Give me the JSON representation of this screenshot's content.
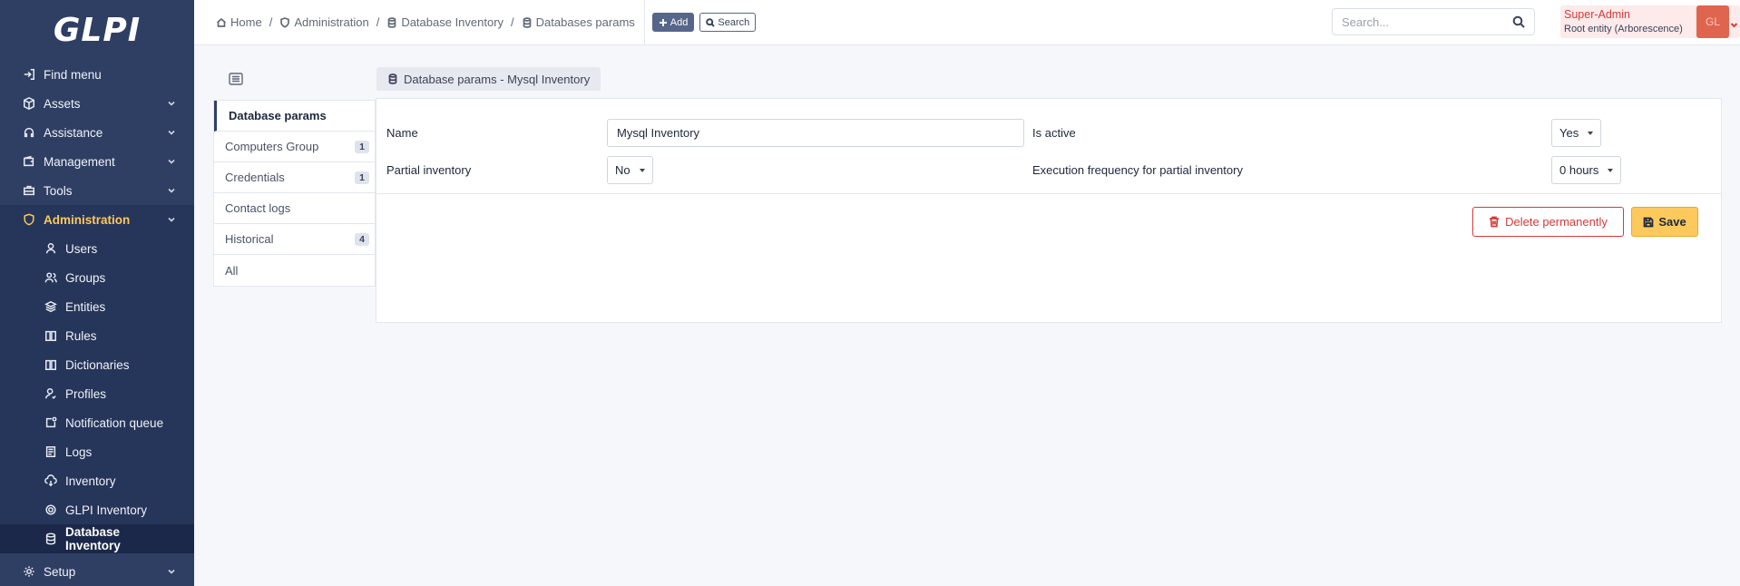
{
  "app": {
    "logo_text": "GLPI"
  },
  "sidebar": {
    "items": [
      {
        "label": "Find menu",
        "icon": "find-menu-icon"
      },
      {
        "label": "Assets",
        "icon": "cube-icon"
      },
      {
        "label": "Assistance",
        "icon": "headset-icon"
      },
      {
        "label": "Management",
        "icon": "wallet-icon"
      },
      {
        "label": "Tools",
        "icon": "briefcase-icon"
      },
      {
        "label": "Administration",
        "icon": "shield-icon"
      }
    ],
    "admin_subitems": [
      {
        "label": "Users",
        "icon": "user-icon"
      },
      {
        "label": "Groups",
        "icon": "users-icon"
      },
      {
        "label": "Entities",
        "icon": "stack-icon"
      },
      {
        "label": "Rules",
        "icon": "book-icon"
      },
      {
        "label": "Dictionaries",
        "icon": "book-icon"
      },
      {
        "label": "Profiles",
        "icon": "user-check-icon"
      },
      {
        "label": "Notification queue",
        "icon": "notification-icon"
      },
      {
        "label": "Logs",
        "icon": "news-icon"
      },
      {
        "label": "Inventory",
        "icon": "cloud-download-icon"
      },
      {
        "label": "GLPI Inventory",
        "icon": "settings-icon"
      },
      {
        "label": "Database Inventory",
        "icon": "database-icon"
      }
    ],
    "setup": {
      "label": "Setup",
      "icon": "gear-icon"
    }
  },
  "header": {
    "breadcrumb": [
      "Home",
      "Administration",
      "Database Inventory",
      "Databases params"
    ],
    "add_label": "Add",
    "search_label": "Search",
    "global_search_placeholder": "Search...",
    "user_name": "Super-Admin",
    "user_entity": "Root entity (Arborescence)",
    "avatar_initials": "GL"
  },
  "page": {
    "title": "Database params - Mysql Inventory",
    "tabs": [
      {
        "label": "Database params",
        "count": ""
      },
      {
        "label": "Computers Group",
        "count": "1"
      },
      {
        "label": "Credentials",
        "count": "1"
      },
      {
        "label": "Contact logs",
        "count": ""
      },
      {
        "label": "Historical",
        "count": "4"
      },
      {
        "label": "All",
        "count": ""
      }
    ]
  },
  "form": {
    "name_label": "Name",
    "name_value": "Mysql Inventory",
    "is_active_label": "Is active",
    "is_active_value": "Yes",
    "partial_label": "Partial inventory",
    "partial_value": "No",
    "frequency_label": "Execution frequency for partial inventory",
    "frequency_value": "0 hours",
    "delete_label": "Delete permanently",
    "save_label": "Save"
  },
  "colors": {
    "sidebar_bg": "#2f3f64",
    "active_accent": "#fec95c",
    "danger": "#d63939",
    "save_bg": "#fec95c"
  }
}
